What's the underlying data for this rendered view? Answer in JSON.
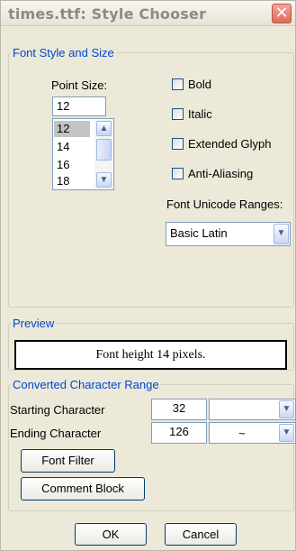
{
  "window": {
    "title": "times.ttf:  Style Chooser",
    "close_glyph": "✕"
  },
  "font_style": {
    "legend": "Font Style and Size",
    "point_size_label": "Point Size:",
    "point_size_value": "12",
    "sizes": [
      "12",
      "14",
      "16",
      "18"
    ],
    "selected_size": "12",
    "checkboxes": [
      {
        "label": "Bold",
        "checked": false
      },
      {
        "label": "Italic",
        "checked": false
      },
      {
        "label": "Extended Glyph",
        "checked": false
      },
      {
        "label": "Anti-Aliasing",
        "checked": false
      }
    ],
    "unicode_ranges_label": "Font Unicode Ranges:",
    "unicode_range_value": "Basic Latin"
  },
  "preview": {
    "legend": "Preview",
    "text": "Font height 14 pixels."
  },
  "range": {
    "legend": "Converted Character Range",
    "start_label": "Starting Character",
    "start_value": "32",
    "start_char": "",
    "end_label": "Ending Character",
    "end_value": "126",
    "end_char": "~",
    "font_filter_label": "Font Filter",
    "comment_block_label": "Comment Block"
  },
  "buttons": {
    "ok": "OK",
    "cancel": "Cancel"
  },
  "icons": {
    "scroll_up": "chevron-up-icon",
    "scroll_down": "chevron-down-icon",
    "combo_arrow": "chevron-down-icon",
    "close": "close-icon"
  }
}
